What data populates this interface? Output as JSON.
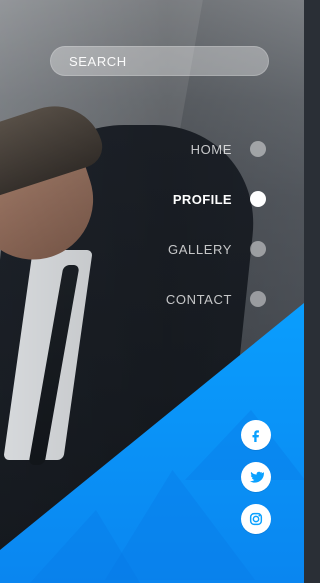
{
  "search": {
    "placeholder": "SEARCH"
  },
  "menu": {
    "items": [
      {
        "label": "HOME",
        "active": false
      },
      {
        "label": "PROFILE",
        "active": true
      },
      {
        "label": "GALLERY",
        "active": false
      },
      {
        "label": "CONTACT",
        "active": false
      }
    ]
  },
  "social": {
    "items": [
      {
        "icon": "facebook-icon"
      },
      {
        "icon": "twitter-icon"
      },
      {
        "icon": "instagram-icon"
      }
    ]
  },
  "colors": {
    "accent_blue": "#0aa1ff",
    "text_white": "#ffffff",
    "inactive_dot": "rgba(255,255,255,0.45)"
  }
}
